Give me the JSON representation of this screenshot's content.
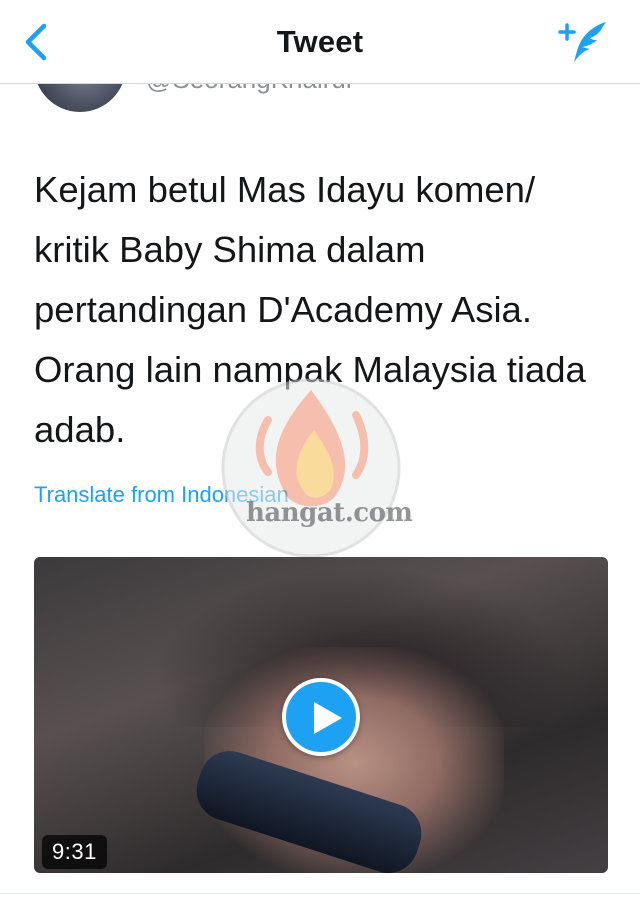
{
  "nav": {
    "back_icon": "chevron-left-icon",
    "title": "Tweet",
    "compose_icon": "compose-feather-icon",
    "accent": "#1da1f2"
  },
  "author": {
    "handle": "@SeorangKhairul"
  },
  "tweet": {
    "text": "Kejam betul Mas Idayu komen/ kritik Baby Shima dalam pertandingan D'Academy Asia. Orang lain nampak Malaysia tiada adab.",
    "lines": [
      "Kejam betul Mas Idayu komen/",
      "kritik Baby Shima dalam",
      "pertandingan D'Academy Asia.",
      "Orang lain nampak Malaysia tiada",
      "adab."
    ],
    "translate_label": "Translate from Indonesian"
  },
  "watermark": {
    "text": "hangat.com"
  },
  "video": {
    "play_icon": "play-icon",
    "duration": "9:31"
  }
}
